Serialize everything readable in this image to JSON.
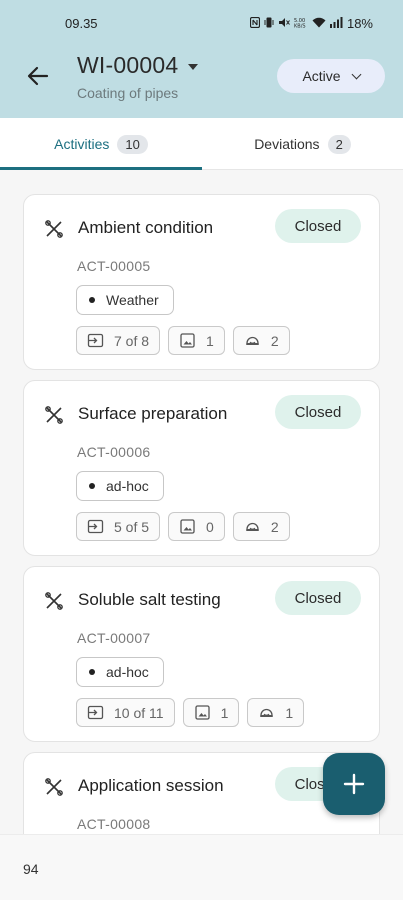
{
  "status_bar": {
    "time": "09.35",
    "icons": [
      "nfc-icon",
      "vibrate-icon",
      "mute-icon",
      "data-icon",
      "wifi-icon",
      "signal-icon"
    ],
    "battery": "18%"
  },
  "header": {
    "title": "WI-00004",
    "subtitle": "Coating of pipes",
    "status": "Active"
  },
  "tabs": [
    {
      "label": "Activities",
      "count": "10"
    },
    {
      "label": "Deviations",
      "count": "2"
    }
  ],
  "activities": [
    {
      "title": "Ambient condition",
      "status": "Closed",
      "id": "ACT-00005",
      "tag": "Weather",
      "steps": "7 of 8",
      "images": "1",
      "people": "2"
    },
    {
      "title": "Surface preparation",
      "status": "Closed",
      "id": "ACT-00006",
      "tag": "ad-hoc",
      "steps": "5 of 5",
      "images": "0",
      "people": "2"
    },
    {
      "title": "Soluble salt testing",
      "status": "Closed",
      "id": "ACT-00007",
      "tag": "ad-hoc",
      "steps": "10 of 11",
      "images": "1",
      "people": "1"
    },
    {
      "title": "Application session",
      "status": "Closed",
      "id": "ACT-00008"
    }
  ],
  "footer": {
    "text": "94"
  },
  "colors": {
    "header_bg": "#bfdde3",
    "accent": "#1c6f80",
    "fab": "#1a5e6f",
    "closed_badge": "#dff2ec",
    "status_pill": "#e8edfa"
  }
}
